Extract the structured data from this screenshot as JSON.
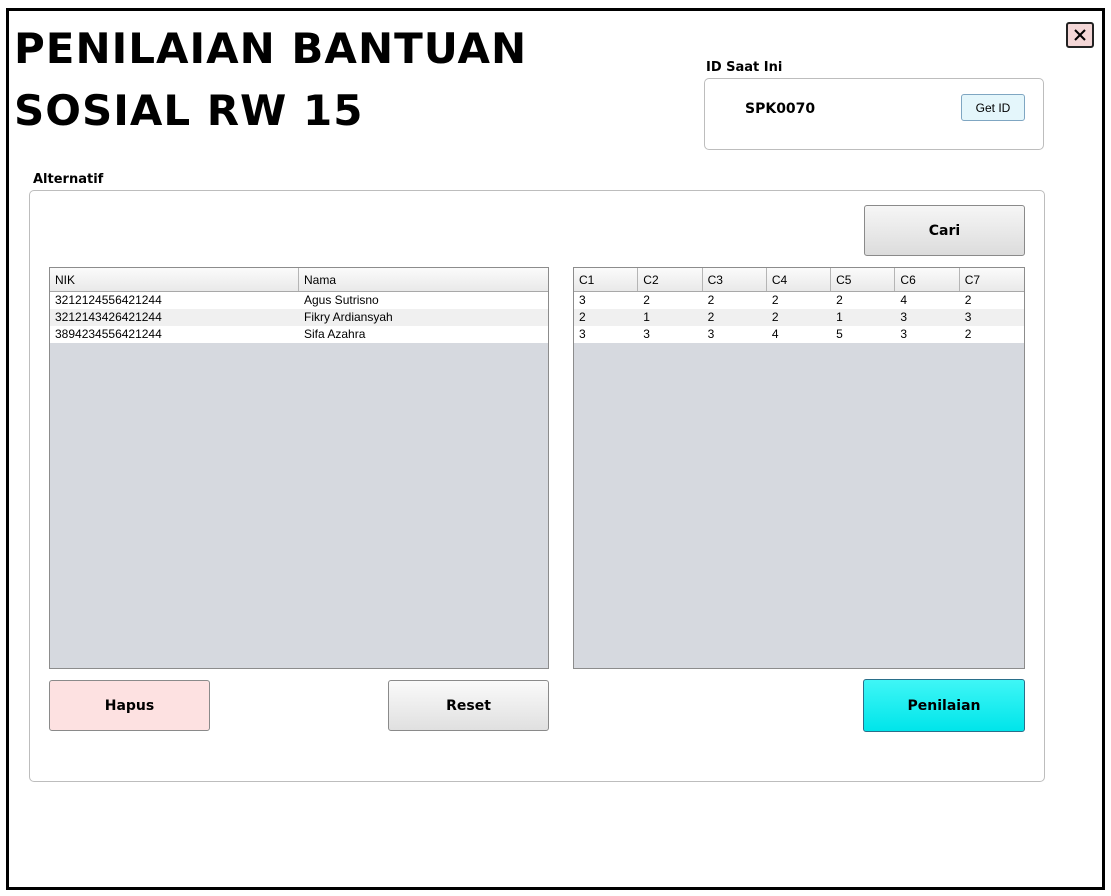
{
  "title_line1": "PENILAIAN BANTUAN",
  "title_line2": "SOSIAL RW 15",
  "id_section": {
    "label": "ID Saat Ini",
    "value": "SPK0070",
    "get_id_label": "Get ID"
  },
  "alternatif": {
    "label": "Alternatif",
    "cari_label": "Cari",
    "left_table": {
      "columns": [
        "NIK",
        "Nama"
      ],
      "rows": [
        [
          "3212124556421244",
          "Agus Sutrisno"
        ],
        [
          "3212143426421244",
          "Fikry Ardiansyah"
        ],
        [
          "3894234556421244",
          "Sifa Azahra"
        ]
      ]
    },
    "right_table": {
      "columns": [
        "C1",
        "C2",
        "C3",
        "C4",
        "C5",
        "C6",
        "C7"
      ],
      "rows": [
        [
          "3",
          "2",
          "2",
          "2",
          "2",
          "4",
          "2"
        ],
        [
          "2",
          "1",
          "2",
          "2",
          "1",
          "3",
          "3"
        ],
        [
          "3",
          "3",
          "3",
          "4",
          "5",
          "3",
          "2"
        ]
      ]
    },
    "hapus_label": "Hapus",
    "reset_label": "Reset",
    "penilaian_label": "Penilaian"
  },
  "colors": {
    "penilaian": "#1EF2F4",
    "hapus": "#FDE1E1",
    "getid": "#E4F6FB"
  }
}
